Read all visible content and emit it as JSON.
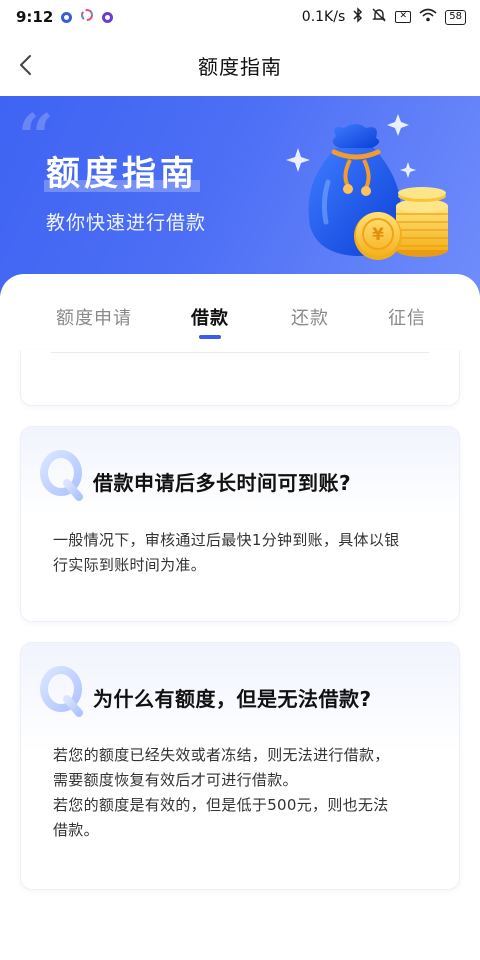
{
  "status_bar": {
    "time": "9:12",
    "net_speed": "0.1K/s",
    "battery": "58",
    "icons": [
      "app-notification-icon",
      "pinwheel-icon",
      "app-notification-icon",
      "bluetooth-icon",
      "mute-icon",
      "sim-off-icon",
      "wifi-icon",
      "battery-icon"
    ]
  },
  "nav": {
    "title": "额度指南",
    "back_icon": "chevron-left-icon"
  },
  "banner": {
    "title": "额度指南",
    "subtitle": "教你快速进行借款",
    "art": "money-bag-coins-illustration"
  },
  "tabs": [
    {
      "label": "额度申请",
      "active": false
    },
    {
      "label": "借款",
      "active": true
    },
    {
      "label": "还款",
      "active": false
    },
    {
      "label": "征信",
      "active": false
    }
  ],
  "faqs": [
    {
      "question": "借款申请后多长时间可到账?",
      "answer_lines": [
        "一般情况下，审核通过后最快1分钟到账，具体以银",
        "行实际到账时间为准。"
      ]
    },
    {
      "question": "为什么有额度，但是无法借款?",
      "answer_lines": [
        "若您的额度已经失效或者冻结，则无法进行借款，",
        "需要额度恢复有效后才可进行借款。",
        "若您的额度是有效的，但是低于500元，则也无法",
        "借款。"
      ]
    }
  ],
  "colors": {
    "accent": "#3a5cf0",
    "banner_start": "#3f63f3",
    "banner_end": "#6f8dfb",
    "tab_inactive": "#8a8a8a"
  }
}
